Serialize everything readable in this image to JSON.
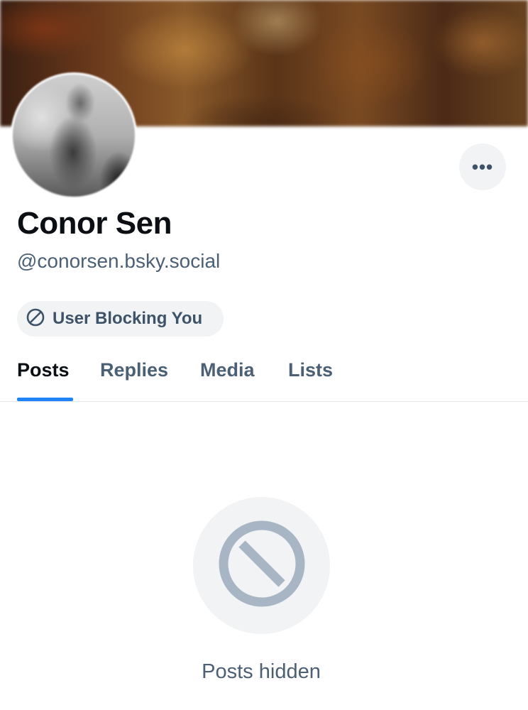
{
  "profile": {
    "display_name": "Conor Sen",
    "handle": "@conorsen.bsky.social",
    "more_label": "•••"
  },
  "status": {
    "blocking_label": "User Blocking You",
    "icon": "block-icon"
  },
  "tabs": [
    {
      "label": "Posts",
      "active": true
    },
    {
      "label": "Replies",
      "active": false
    },
    {
      "label": "Media",
      "active": false
    },
    {
      "label": "Lists",
      "active": false
    }
  ],
  "feed": {
    "empty_icon": "block-icon",
    "empty_message": "Posts hidden"
  },
  "colors": {
    "accent": "#1f84f5",
    "muted_text": "#4b6075",
    "icon_gray": "#a8b5c4",
    "pill_bg": "#f1f3f5"
  }
}
